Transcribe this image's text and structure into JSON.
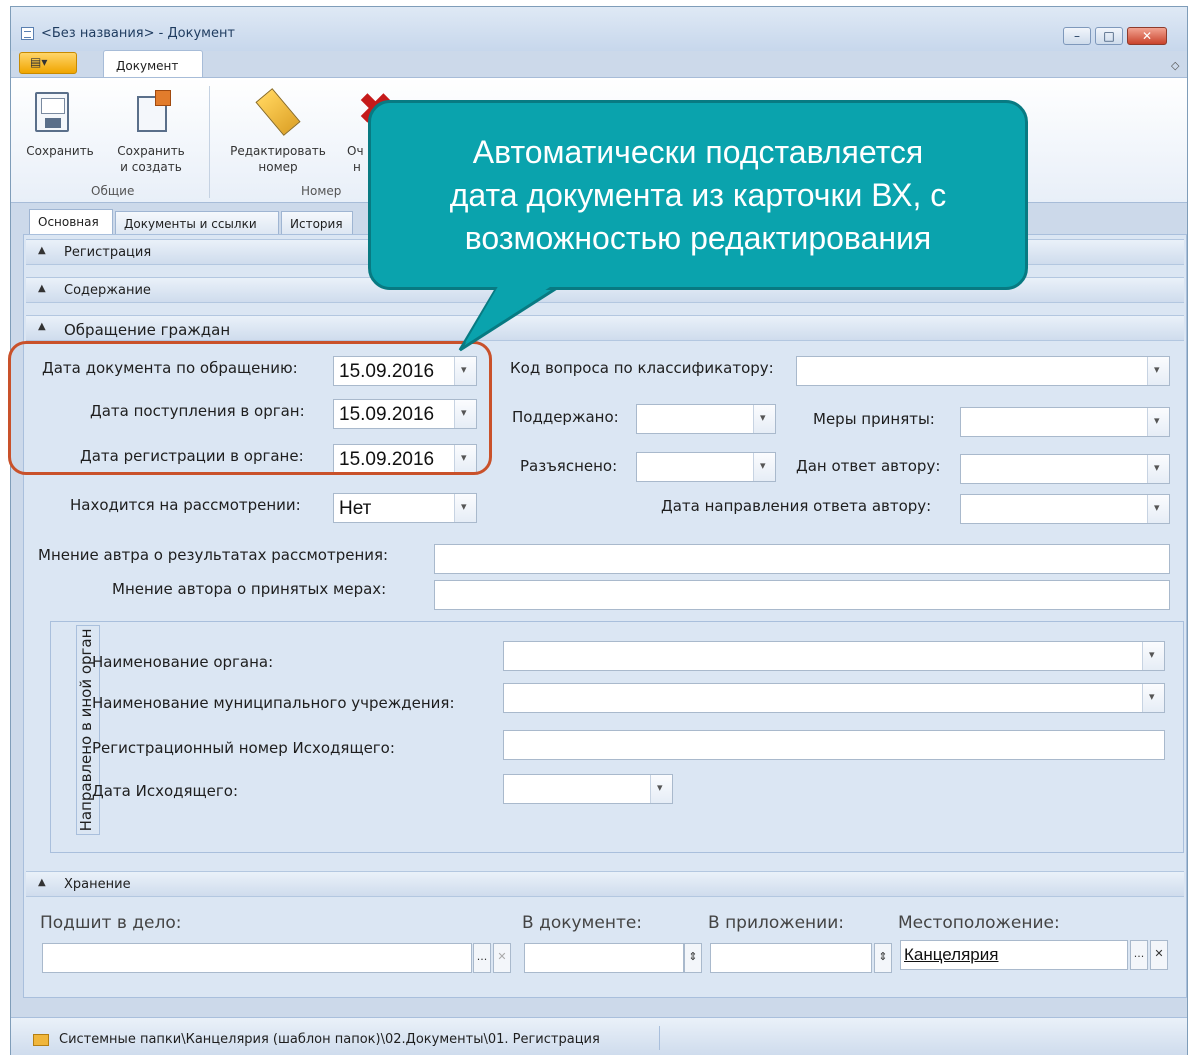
{
  "window": {
    "title": "<Без названия> - Документ",
    "minimize_glyph": "–",
    "maximize_glyph": "□",
    "close_glyph": "✕"
  },
  "app_menu": {
    "glyph": "▤▾"
  },
  "ribbon": {
    "tab": "Документ",
    "buttons": {
      "save": "Сохранить",
      "save_and_create_line1": "Сохранить",
      "save_and_create_line2": "и создать",
      "edit_number_line1": "Редактировать",
      "edit_number_line2": "номер",
      "clear_line1": "Оч",
      "clear_line2": "н"
    },
    "groups": {
      "general": "Общие",
      "number": "Номер"
    }
  },
  "tabs": [
    "Основная",
    "Документы и ссылки",
    "История"
  ],
  "sections": {
    "registration": "Регистрация",
    "content": "Содержание",
    "citizens": "Обращение граждан",
    "storage": "Хранение"
  },
  "form": {
    "doc_date_label": "Дата документа по обращению:",
    "doc_date_value": "15.09.2016",
    "receipt_date_label": "Дата поступления в орган:",
    "receipt_date_value": "15.09.2016",
    "reg_date_label": "Дата регистрации в органе:",
    "reg_date_value": "15.09.2016",
    "under_review_label": "Находится на рассмотрении:",
    "under_review_value": "Нет",
    "question_code_label": "Код вопроса по классификатору:",
    "supported_label": "Поддержано:",
    "measures_label": "Меры приняты:",
    "explained_label": "Разъяснено:",
    "answer_label": "Дан ответ автору:",
    "answer_date_label": "Дата направления ответа автору:",
    "opinion_results_label": "Мнение автра о результатах рассмотрения:",
    "opinion_measures_label": "Мнение автора о принятых мерах:"
  },
  "redirect_group": {
    "title": "Направлено в иной орган",
    "org_name_label": "Наименование органа:",
    "municipal_label": "Наименование муниципального учреждения:",
    "outgoing_number_label": "Регистрационный номер Исходящего:",
    "outgoing_date_label": "Дата Исходящего:"
  },
  "storage": {
    "case_label": "Подшит в дело:",
    "in_doc_label": "В документе:",
    "in_app_label": "В приложении:",
    "location_label": "Местоположение:",
    "location_value": "Канцелярия",
    "ellipsis": "...",
    "clear": "✕"
  },
  "status": {
    "path": "Системные папки\\Канцелярия (шаблон папок)\\02.Документы\\01. Регистрация"
  },
  "callout": {
    "line1": "Автоматически подставляется",
    "line2": "дата документа из карточки ВХ, с",
    "line3": "возможностью редактирования"
  },
  "colors": {
    "callout": "#0aa3ad",
    "highlight": "#c9512a"
  }
}
